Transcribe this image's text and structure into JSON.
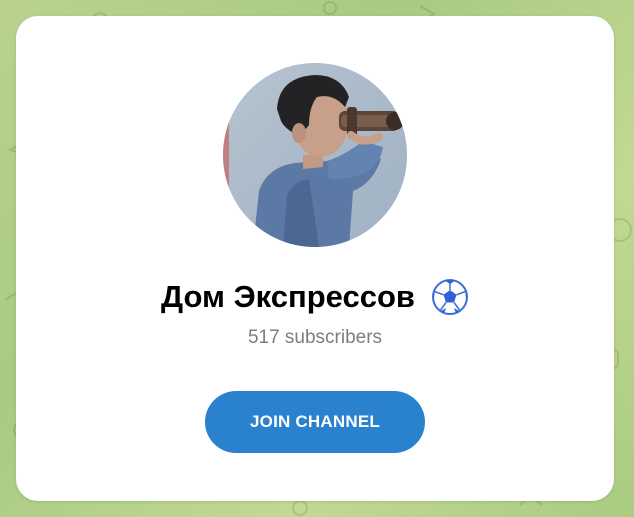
{
  "channel": {
    "title": "Дом Экспрессов",
    "title_emoji": "soccer-ball-icon",
    "subscribers_text": "517 subscribers",
    "avatar": "channel-avatar-boy-with-binoculars"
  },
  "actions": {
    "join_label": "JOIN CHANNEL"
  },
  "colors": {
    "background": "#aecd86",
    "card": "#ffffff",
    "button": "#2a82cf",
    "button_text": "#ffffff",
    "subtitle": "#7d7d7d"
  }
}
